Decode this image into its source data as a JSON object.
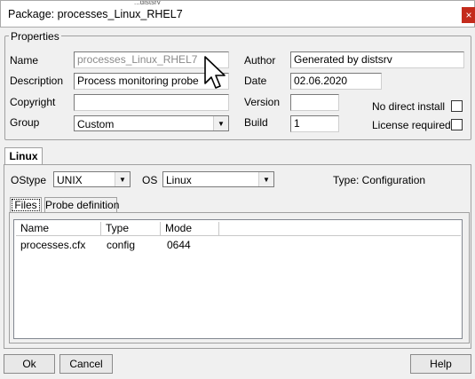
{
  "window": {
    "title": "Package: processes_Linux_RHEL7",
    "close_glyph": "×",
    "background_strip": "...distsrv"
  },
  "properties": {
    "legend": "Properties",
    "name_label": "Name",
    "name_value": "processes_Linux_RHEL7",
    "description_label": "Description",
    "description_value": "Process monitoring probe",
    "copyright_label": "Copyright",
    "copyright_value": "",
    "group_label": "Group",
    "group_value": "Custom",
    "author_label": "Author",
    "author_value": "Generated by distsrv",
    "date_label": "Date",
    "date_value": "02.06.2020",
    "version_label": "Version",
    "version_value": "",
    "build_label": "Build",
    "build_value": "1",
    "no_direct_install_label": "No direct install",
    "license_required_label": "License required"
  },
  "os_tabs": [
    {
      "label": "Linux"
    }
  ],
  "platform": {
    "ostype_label": "OStype",
    "ostype_value": "UNIX",
    "os_label": "OS",
    "os_value": "Linux",
    "type_text": "Type: Configuration"
  },
  "sub_tabs": [
    {
      "label": "Files"
    },
    {
      "label": "Probe definition"
    }
  ],
  "files_table": {
    "columns": [
      "Name",
      "Type",
      "Mode"
    ],
    "rows": [
      {
        "name": "processes.cfx",
        "type": "config",
        "mode": "0644"
      }
    ]
  },
  "buttons": {
    "ok": "Ok",
    "cancel": "Cancel",
    "help": "Help"
  },
  "icons": {
    "dropdown": "chevron-down-icon",
    "cursor": "mouse-pointer-icon"
  },
  "colors": {
    "close_button": "#c42b1c",
    "window_bg": "#f0f0f0"
  }
}
